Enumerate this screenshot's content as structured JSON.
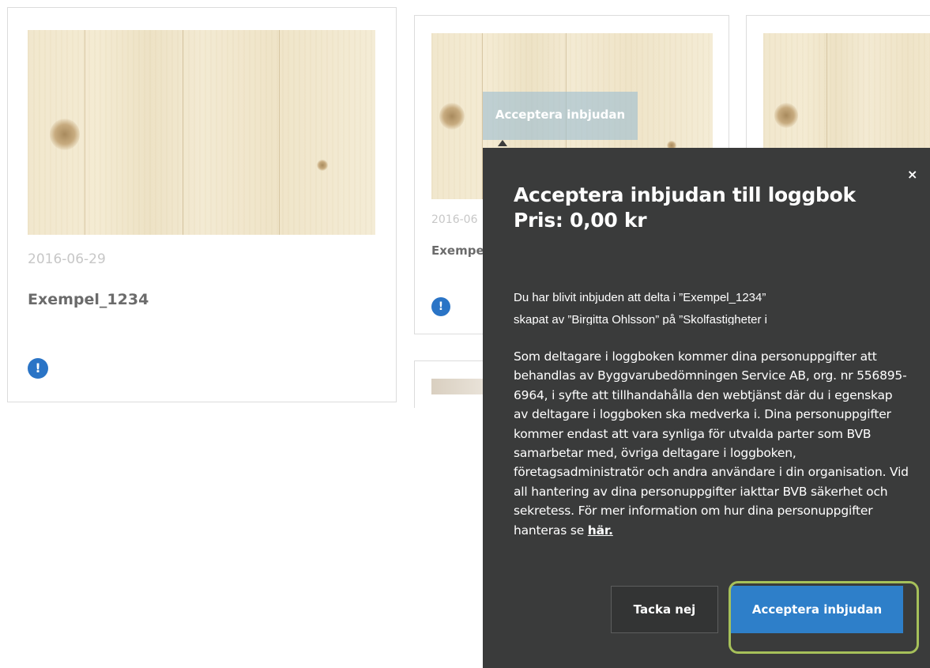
{
  "cards": [
    {
      "date": "2016-06-29",
      "title": "Exempel_1234",
      "alert": "!"
    },
    {
      "date": "2016-06",
      "title": "Exempe",
      "alert": "!"
    }
  ],
  "tooltip": {
    "label": "Acceptera inbjudan"
  },
  "modal": {
    "close_label": "×",
    "title_line1": "Acceptera inbjudan till loggbok",
    "title_line2": "Pris: 0,00 kr",
    "intro_line1": "Du har blivit inbjuden att delta i ”Exempel_1234”",
    "intro_line2": "skapat av ”Birgitta Ohlsson” på ”Skolfastigheter i",
    "privacy_text": "Som deltagare i loggboken kommer dina personuppgifter att behandlas av Byggvarubedömningen Service AB, org. nr 556895-6964, i syfte att tillhandahålla den webtjänst där du i egenskap av deltagare i loggboken ska medverka i. Dina personuppgifter kommer endast att vara synliga för utvalda parter som BVB samarbetar med, övriga deltagare i loggboken, företagsadministratör och andra användare i din organisation. Vid all hantering av dina personuppgifter iakttar BVB säkerhet och sekretess. För mer information om hur dina personuppgifter hanteras se",
    "privacy_link": "här.",
    "decline_label": "Tacka nej",
    "accept_label": "Acceptera inbjudan"
  },
  "colors": {
    "modal_bg": "#3a3b3b",
    "accent": "#2e7fc9",
    "highlight": "#a6c05a"
  }
}
